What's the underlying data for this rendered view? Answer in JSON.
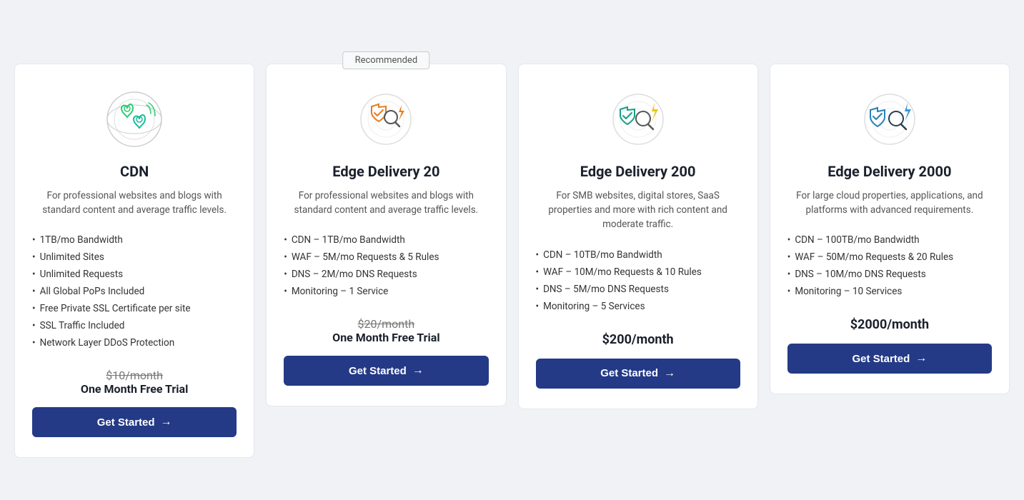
{
  "plans": [
    {
      "id": "cdn",
      "title": "CDN",
      "description": "For professional websites and blogs with standard content and average traffic levels.",
      "recommended": false,
      "features": [
        "1TB/mo Bandwidth",
        "Unlimited Sites",
        "Unlimited Requests",
        "All Global PoPs Included",
        "Free Private SSL Certificate per site",
        "SSL Traffic Included",
        "Network Layer DDoS Protection"
      ],
      "original_price": "$10/month",
      "trial_text": "One Month Free Trial",
      "price": null,
      "button_label": "Get Started",
      "button_arrow": "→"
    },
    {
      "id": "edge-delivery-20",
      "title": "Edge Delivery 20",
      "description": "For professional websites and blogs with standard content and average traffic levels.",
      "recommended": true,
      "features": [
        "CDN – 1TB/mo Bandwidth",
        "WAF – 5M/mo Requests & 5 Rules",
        "DNS – 2M/mo DNS Requests",
        "Monitoring – 1 Service"
      ],
      "original_price": "$20/month",
      "trial_text": "One Month Free Trial",
      "price": null,
      "button_label": "Get Started",
      "button_arrow": "→"
    },
    {
      "id": "edge-delivery-200",
      "title": "Edge Delivery 200",
      "description": "For SMB websites, digital stores, SaaS properties and more with rich content and moderate traffic.",
      "recommended": false,
      "features": [
        "CDN – 10TB/mo Bandwidth",
        "WAF – 10M/mo Requests & 10 Rules",
        "DNS – 5M/mo DNS Requests",
        "Monitoring – 5 Services"
      ],
      "original_price": null,
      "trial_text": null,
      "price": "$200/month",
      "button_label": "Get Started",
      "button_arrow": "→"
    },
    {
      "id": "edge-delivery-2000",
      "title": "Edge Delivery 2000",
      "description": "For large cloud properties, applications, and platforms with advanced requirements.",
      "recommended": false,
      "features": [
        "CDN – 100TB/mo Bandwidth",
        "WAF – 50M/mo Requests & 20 Rules",
        "DNS – 10M/mo DNS Requests",
        "Monitoring – 10 Services"
      ],
      "original_price": null,
      "trial_text": null,
      "price": "$2000/month",
      "button_label": "Get Started",
      "button_arrow": "→"
    }
  ],
  "recommended_label": "Recommended"
}
